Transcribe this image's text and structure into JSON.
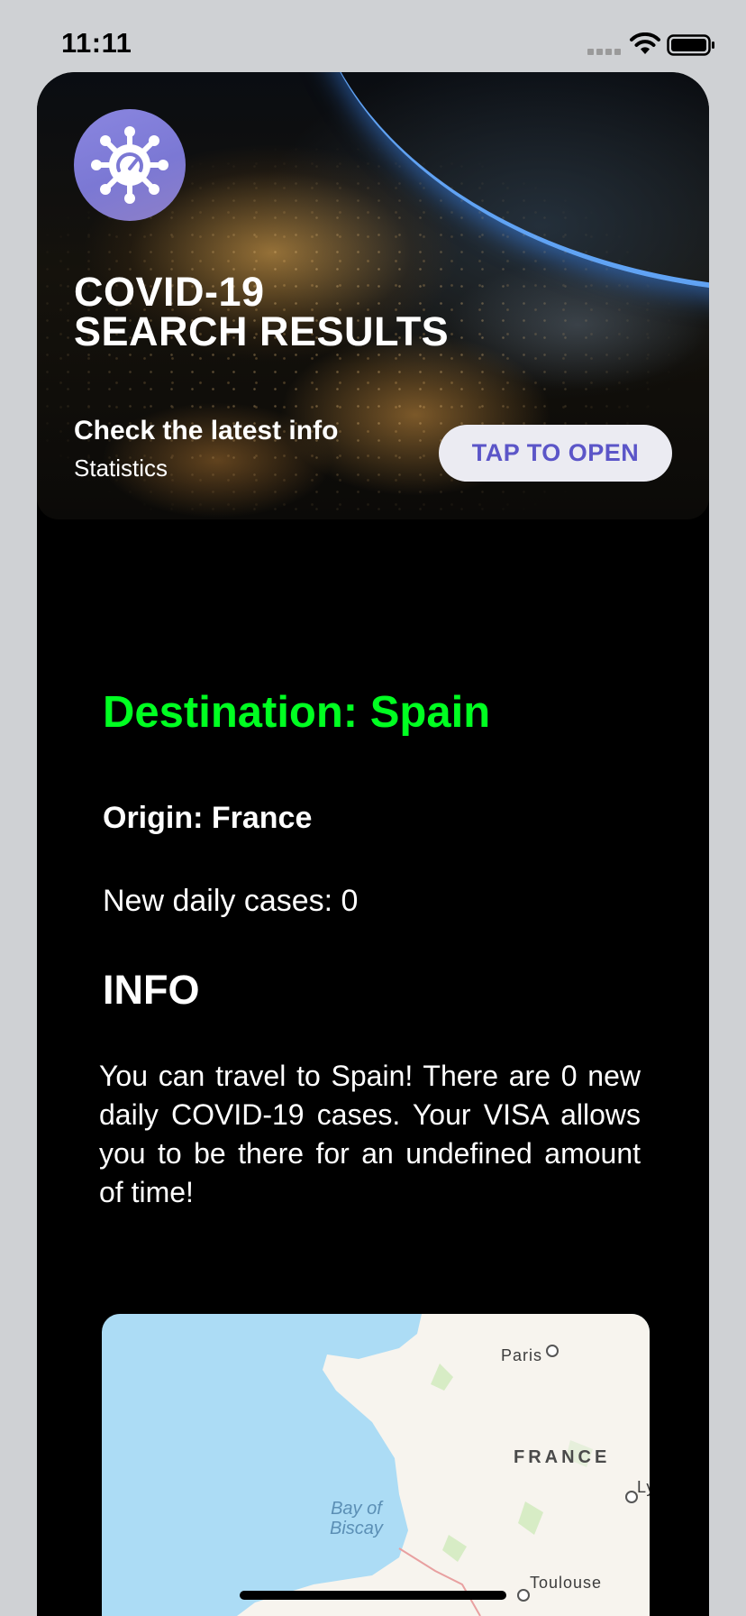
{
  "status_bar": {
    "time": "11:11"
  },
  "hero": {
    "title_line1": "COVID-19",
    "title_line2": "SEARCH RESULTS",
    "subtitle": "Check the latest info",
    "caption": "Statistics",
    "button_label": "TAP TO OPEN"
  },
  "results": {
    "destination": "Destination: Spain",
    "origin": "Origin: France",
    "daily_cases": "New daily cases: 0",
    "info_heading": "INFO",
    "info_text": "You can travel to Spain! There are 0 new daily COVID-19 cases. Your VISA allows you to be there for an undefined amount of time!"
  },
  "map": {
    "city_paris": "Paris",
    "country_france": "FRANCE",
    "city_ly": "Ly",
    "water_line1": "Bay of",
    "water_line2": "Biscay",
    "city_toulouse": "Toulouse"
  },
  "colors": {
    "destination_green": "#00ff21",
    "button_text": "#5b55c8",
    "logo_purple": "#7b78d4",
    "map_water": "#acdcf5",
    "map_land": "#f7f4ee"
  },
  "icons": {
    "status": [
      "signal-icon",
      "wifi-icon",
      "battery-icon"
    ],
    "logo": "virus-icon"
  }
}
